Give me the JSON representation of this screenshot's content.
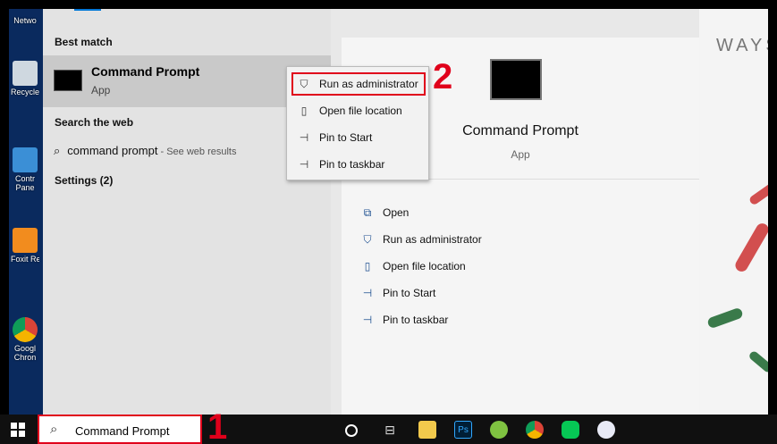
{
  "desktop": {
    "icons": [
      {
        "label": "Netwo"
      },
      {
        "label": "Recycle"
      },
      {
        "label": "Contr Pane"
      },
      {
        "label": "Foxit Re"
      },
      {
        "label": "Googl Chron"
      }
    ],
    "wallpaper_text": "WAYS"
  },
  "start_menu": {
    "best_match_header": "Best match",
    "best_match": {
      "title": "Command Prompt",
      "subtitle": "App"
    },
    "search_web_header": "Search the web",
    "web_result": {
      "query": "command prompt",
      "hint": " - See web results"
    },
    "settings_header": "Settings (2)",
    "context_menu": [
      {
        "label": "Run as administrator",
        "icon": "shield-run-icon"
      },
      {
        "label": "Open file location",
        "icon": "file-location-icon"
      },
      {
        "label": "Pin to Start",
        "icon": "pin-icon"
      },
      {
        "label": "Pin to taskbar",
        "icon": "pin-icon"
      }
    ],
    "annotation_two": "2",
    "right_pane": {
      "title": "Command Prompt",
      "subtitle": "App",
      "actions": [
        {
          "label": "Open",
          "icon": "open-icon"
        },
        {
          "label": "Run as administrator",
          "icon": "shield-run-icon"
        },
        {
          "label": "Open file location",
          "icon": "file-location-icon"
        },
        {
          "label": "Pin to Start",
          "icon": "pin-icon"
        },
        {
          "label": "Pin to taskbar",
          "icon": "pin-icon"
        }
      ]
    }
  },
  "taskbar": {
    "search_value": "Command Prompt",
    "annotation_one": "1",
    "ps_label": "Ps"
  },
  "colors": {
    "highlight_red": "#e0001b",
    "accent_blue": "#0078d7"
  }
}
